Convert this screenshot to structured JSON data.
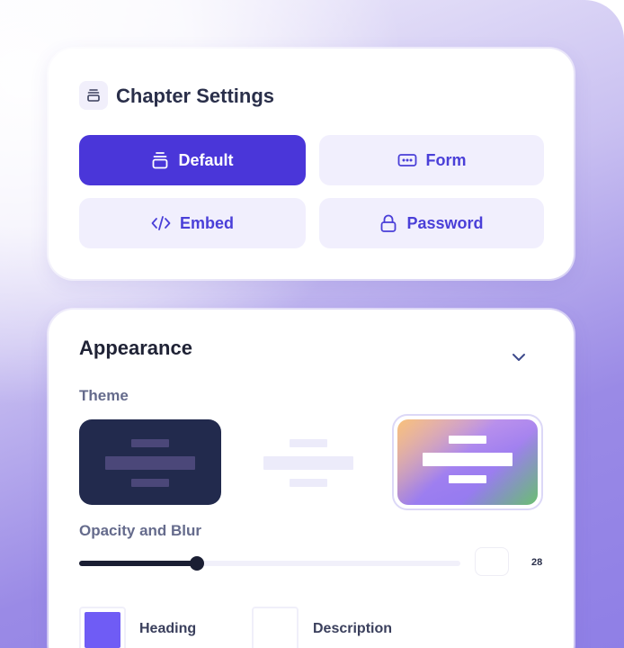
{
  "chapter_settings": {
    "title": "Chapter Settings",
    "options": [
      {
        "label": "Default",
        "icon": "stack-icon",
        "active": true
      },
      {
        "label": "Form",
        "icon": "input-field-icon",
        "active": false
      },
      {
        "label": "Embed",
        "icon": "code-icon",
        "active": false
      },
      {
        "label": "Password",
        "icon": "lock-icon",
        "active": false
      }
    ]
  },
  "appearance": {
    "title": "Appearance",
    "theme_label": "Theme",
    "themes": [
      {
        "name": "dark",
        "color": "#222a4d",
        "selected": false
      },
      {
        "name": "light",
        "color": "#ecebfa",
        "selected": false
      },
      {
        "name": "gradient",
        "color": "#9f7ff0",
        "selected": true
      }
    ],
    "opacity_label": "Opacity and Blur",
    "opacity_value": "28",
    "slider_fraction": 0.31,
    "colors": [
      {
        "label": "Heading",
        "color": "#6f5cf5"
      },
      {
        "label": "Description",
        "color": "#ffffff"
      }
    ]
  },
  "colors": {
    "accent": "#4a36d9",
    "option_bg": "#f1effd",
    "title_text": "#2a2f4a"
  }
}
